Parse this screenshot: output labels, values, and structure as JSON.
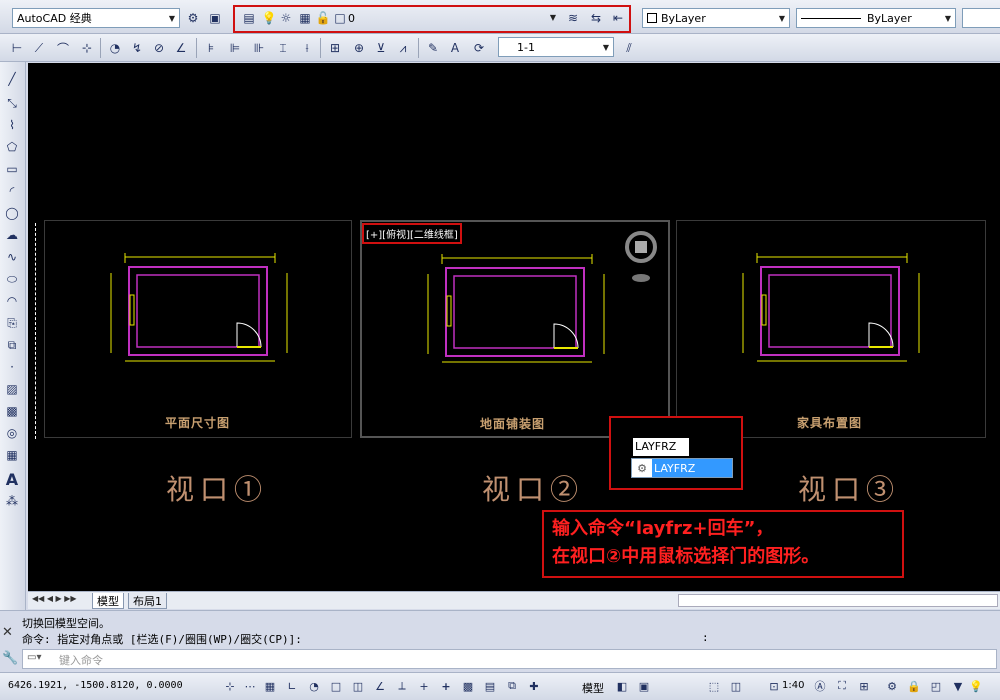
{
  "toolbar1": {
    "workspace": "AutoCAD 经典",
    "layer_name": "0",
    "color": "ByLayer",
    "linetype": "ByLayer"
  },
  "toolbar2": {
    "dimstyle": "1-1"
  },
  "viewports": [
    {
      "label": "平面尺寸图",
      "title": "视口①"
    },
    {
      "label": "地面铺装图",
      "title": "视口②",
      "control": "[+][俯视][二维线框]"
    },
    {
      "label": "家具布置图",
      "title": "视口③"
    }
  ],
  "autocomplete": {
    "typed": "LAYFRZ",
    "suggestion": "LAYFRZ"
  },
  "annotation": {
    "line1": "输入命令“layfrz+回车”，",
    "line2": "在视口②中用鼠标选择门的图形。"
  },
  "tabs": {
    "model": "模型",
    "layout1": "布局1"
  },
  "command": {
    "history1": "切换回模型空间。",
    "history2": "命令: 指定对角点或 [栏选(F)/圈围(WP)/圈交(CP)]:",
    "history2_tail": ":",
    "placeholder": "键入命令"
  },
  "status": {
    "coords": "6426.1921,  -1500.8120, 0.0000",
    "model": "模型",
    "scale": "1:40"
  },
  "colors": {
    "accent_red": "#d01010",
    "plan_magenta": "#c030c0",
    "dim_yellow": "#e8e800",
    "label_tan": "#c8a070"
  }
}
